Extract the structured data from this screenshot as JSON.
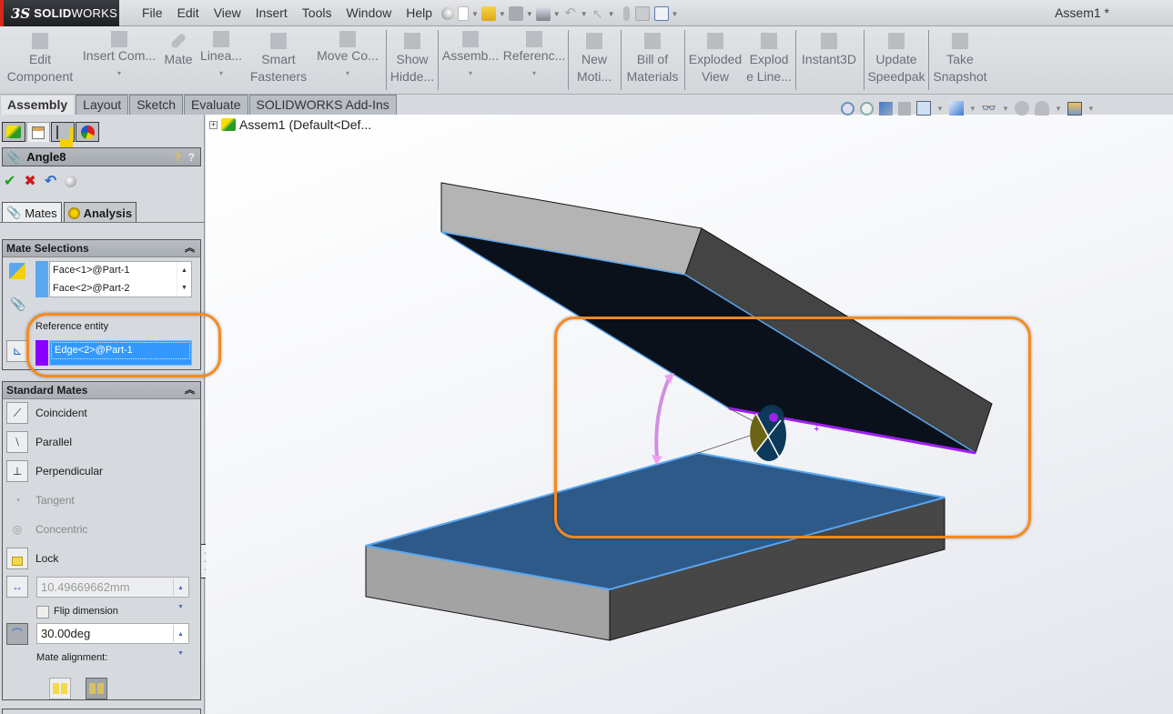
{
  "app": {
    "logo_prefix": "3S",
    "logo_bold": "SOLID",
    "logo_rest": "WORKS",
    "document_title": "Assem1 *",
    "menus": [
      "File",
      "Edit",
      "View",
      "Insert",
      "Tools",
      "Window",
      "Help"
    ]
  },
  "quick_access": [
    {
      "icon": "new-document-icon"
    },
    {
      "icon": "open-folder-icon"
    },
    {
      "icon": "save-icon"
    },
    {
      "icon": "print-icon"
    },
    {
      "icon": "undo-icon"
    },
    {
      "icon": "select-pointer-icon"
    },
    {
      "icon": "rebuild-icon"
    },
    {
      "icon": "file-properties-icon"
    },
    {
      "icon": "options-icon"
    }
  ],
  "command_manager": {
    "buttons": [
      {
        "line1": "Edit",
        "line2": "Component",
        "icon": "edit-component-icon"
      },
      {
        "line1": "Insert Com...",
        "line2": "⌄",
        "icon": "insert-component-icon"
      },
      {
        "line1": "Mate",
        "line2": "",
        "icon": "mate-icon"
      },
      {
        "line1": "Linea...",
        "line2": "⌄",
        "icon": "linear-pattern-icon"
      },
      {
        "line1": "Smart",
        "line2": "Fasteners",
        "icon": "smart-fasteners-icon"
      },
      {
        "line1": "Move Co...",
        "line2": "⌄",
        "icon": "move-component-icon"
      },
      {
        "line1": "Show",
        "line2": "Hidde...",
        "icon": "show-hidden-icon"
      },
      {
        "line1": "Assemb...",
        "line2": "⌄",
        "icon": "assembly-features-icon"
      },
      {
        "line1": "Referenc...",
        "line2": "⌄",
        "icon": "reference-geometry-icon"
      },
      {
        "line1": "New",
        "line2": "Moti...",
        "icon": "new-motion-study-icon"
      },
      {
        "line1": "Bill of",
        "line2": "Materials",
        "icon": "bill-of-materials-icon"
      },
      {
        "line1": "Exploded",
        "line2": "View",
        "icon": "exploded-view-icon"
      },
      {
        "line1": "Explod",
        "line2": "e Line...",
        "icon": "explode-line-sketch-icon"
      },
      {
        "line1": "Instant3D",
        "line2": "",
        "icon": "instant3d-icon"
      },
      {
        "line1": "Update",
        "line2": "Speedpak",
        "icon": "update-speedpak-icon"
      },
      {
        "line1": "Take",
        "line2": "Snapshot",
        "icon": "take-snapshot-icon"
      }
    ],
    "tabs": [
      "Assembly",
      "Layout",
      "Sketch",
      "Evaluate",
      "SOLIDWORKS Add-Ins"
    ],
    "active_tab": "Assembly"
  },
  "feature_tree": {
    "root_label": "Assem1  (Default<Def..."
  },
  "property_manager": {
    "title": "Angle8",
    "help_label": "?",
    "subtabs": [
      "Mates",
      "Analysis"
    ],
    "mate_selections": {
      "header": "Mate Selections",
      "items": [
        "Face<1>@Part-1",
        "Face<2>@Part-2"
      ],
      "reference_label": "Reference entity",
      "reference_value": "Edge<2>@Part-1",
      "selection_color": "#5aa7f0",
      "reference_color": "#8a00ff"
    },
    "standard_mates": {
      "header": "Standard Mates",
      "items": [
        {
          "label": "Coincident",
          "enabled": true
        },
        {
          "label": "Parallel",
          "enabled": true
        },
        {
          "label": "Perpendicular",
          "enabled": true
        },
        {
          "label": "Tangent",
          "enabled": false
        },
        {
          "label": "Concentric",
          "enabled": false
        },
        {
          "label": "Lock",
          "enabled": true
        }
      ],
      "distance_value": "10.49669662mm",
      "flip_label": "Flip dimension",
      "angle_value": "30.00deg",
      "alignment_label": "Mate alignment:"
    }
  },
  "colors": {
    "callout": "#f58a1f",
    "highlight_face": "#2e5a8a",
    "highlight_edge": "#5aa7f0",
    "reference_edge": "#a020f0"
  }
}
